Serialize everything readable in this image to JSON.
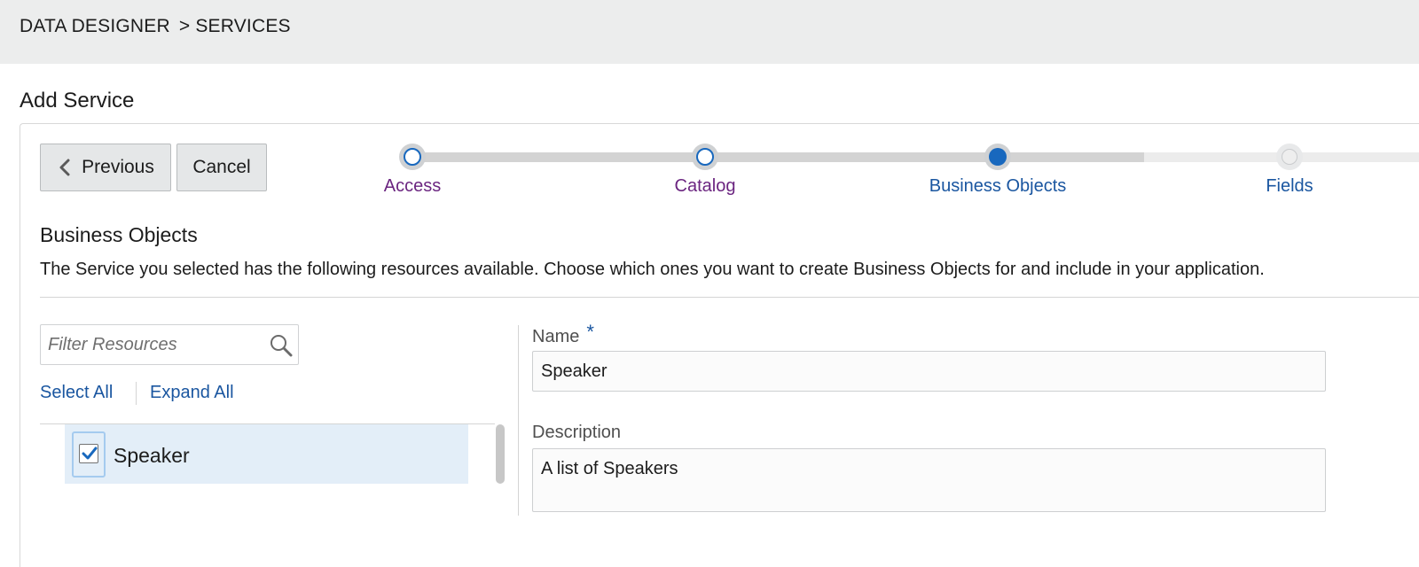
{
  "breadcrumb": {
    "root": "DATA DESIGNER",
    "separator": ">",
    "current": "SERVICES"
  },
  "page_title": "Add Service",
  "buttons": {
    "previous": "Previous",
    "cancel": "Cancel"
  },
  "train": {
    "steps": [
      {
        "label": "Access",
        "state": "visited"
      },
      {
        "label": "Catalog",
        "state": "visited"
      },
      {
        "label": "Business Objects",
        "state": "current"
      },
      {
        "label": "Fields",
        "state": "future"
      }
    ]
  },
  "section": {
    "title": "Business Objects",
    "description": "The Service you selected has the following resources available. Choose which ones you want to create Business Objects for and include in your application."
  },
  "filter": {
    "placeholder": "Filter Resources",
    "value": ""
  },
  "links": {
    "select_all": "Select All",
    "expand_all": "Expand All"
  },
  "resources": [
    {
      "label": "Speaker",
      "checked": true
    }
  ],
  "form": {
    "name_label": "Name",
    "required_mark": "*",
    "name_value": "Speaker",
    "description_label": "Description",
    "description_value": "A list of Speakers"
  },
  "colors": {
    "accent": "#1868be",
    "visited_link": "#6b2580",
    "link": "#1a56a0",
    "header_bg": "#eceded",
    "selected_row": "#e3eef8"
  }
}
